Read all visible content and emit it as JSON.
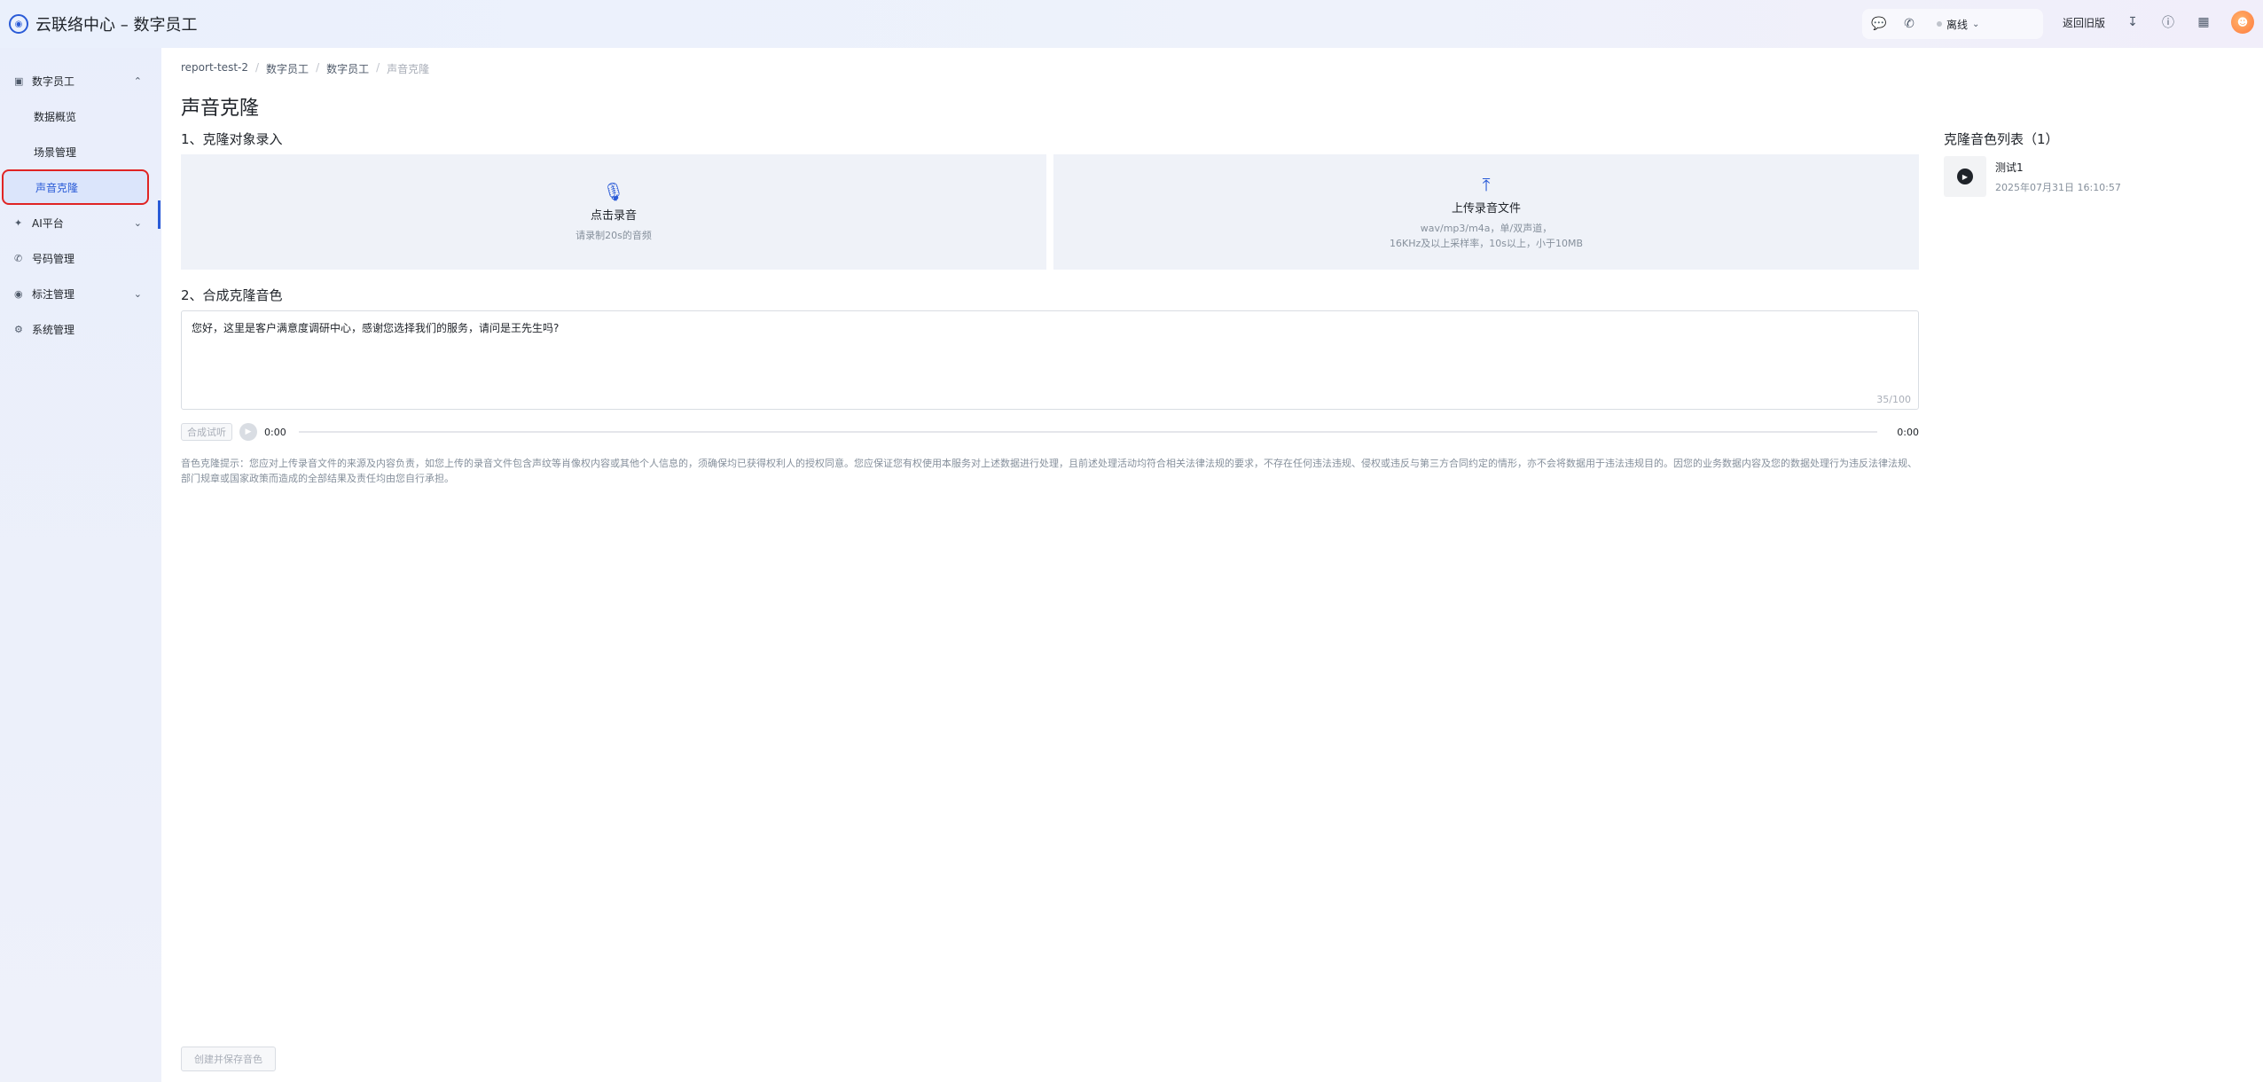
{
  "header": {
    "logo_glyph": "◉",
    "title": "云联络中心 – 数字员工",
    "tools": {
      "chat_icon": "chat-bubble-icon",
      "phone_icon": "phone-icon",
      "status_label": "离线"
    },
    "return_old": "返回旧版",
    "download_icon": "download-icon",
    "help_icon": "help-icon",
    "apps_icon": "apps-grid-icon"
  },
  "sidebar": {
    "groups": [
      {
        "label": "数字员工",
        "icon": "robot-icon",
        "expanded": true,
        "items": [
          {
            "label": "数据概览"
          },
          {
            "label": "场景管理"
          },
          {
            "label": "声音克隆",
            "active": true
          }
        ]
      },
      {
        "label": "AI平台",
        "icon": "ai-icon",
        "expanded": false
      },
      {
        "label": "号码管理",
        "icon": "phone-icon",
        "expanded": null
      },
      {
        "label": "标注管理",
        "icon": "tag-icon",
        "expanded": false
      },
      {
        "label": "系统管理",
        "icon": "settings-icon",
        "expanded": null
      }
    ]
  },
  "breadcrumb": [
    "report-test-2",
    "数字员工",
    "数字员工",
    "声音克隆"
  ],
  "page_title": "声音克隆",
  "section1": {
    "title": "1、克隆对象录入",
    "record": {
      "title": "点击录音",
      "hint": "请录制20s的音频"
    },
    "upload": {
      "title": "上传录音文件",
      "hint_line1": "wav/mp3/m4a，单/双声道，",
      "hint_line2": "16KHz及以上采样率，10s以上，小于10MB"
    }
  },
  "section2": {
    "title": "2、合成克隆音色",
    "text": "您好，这里是客户满意度调研中心，感谢您选择我们的服务，请问是王先生吗?",
    "counter": "35/100",
    "synth_button": "合成试听",
    "time_start": "0:00",
    "time_end": "0:00",
    "notice": "音色克隆提示：您应对上传录音文件的来源及内容负责，如您上传的录音文件包含声纹等肖像权内容或其他个人信息的，须确保均已获得权利人的授权同意。您应保证您有权使用本服务对上述数据进行处理，且前述处理活动均符合相关法律法规的要求，不存在任何违法违规、侵权或违反与第三方合同约定的情形，亦不会将数据用于违法违规目的。因您的业务数据内容及您的数据处理行为违反法律法规、部门规章或国家政策而造成的全部结果及责任均由您自行承担。"
  },
  "voice_list": {
    "title": "克隆音色列表（1）",
    "items": [
      {
        "name": "测试1",
        "date": "2025年07月31日 16:10:57"
      }
    ]
  },
  "create_button": "创建并保存音色"
}
